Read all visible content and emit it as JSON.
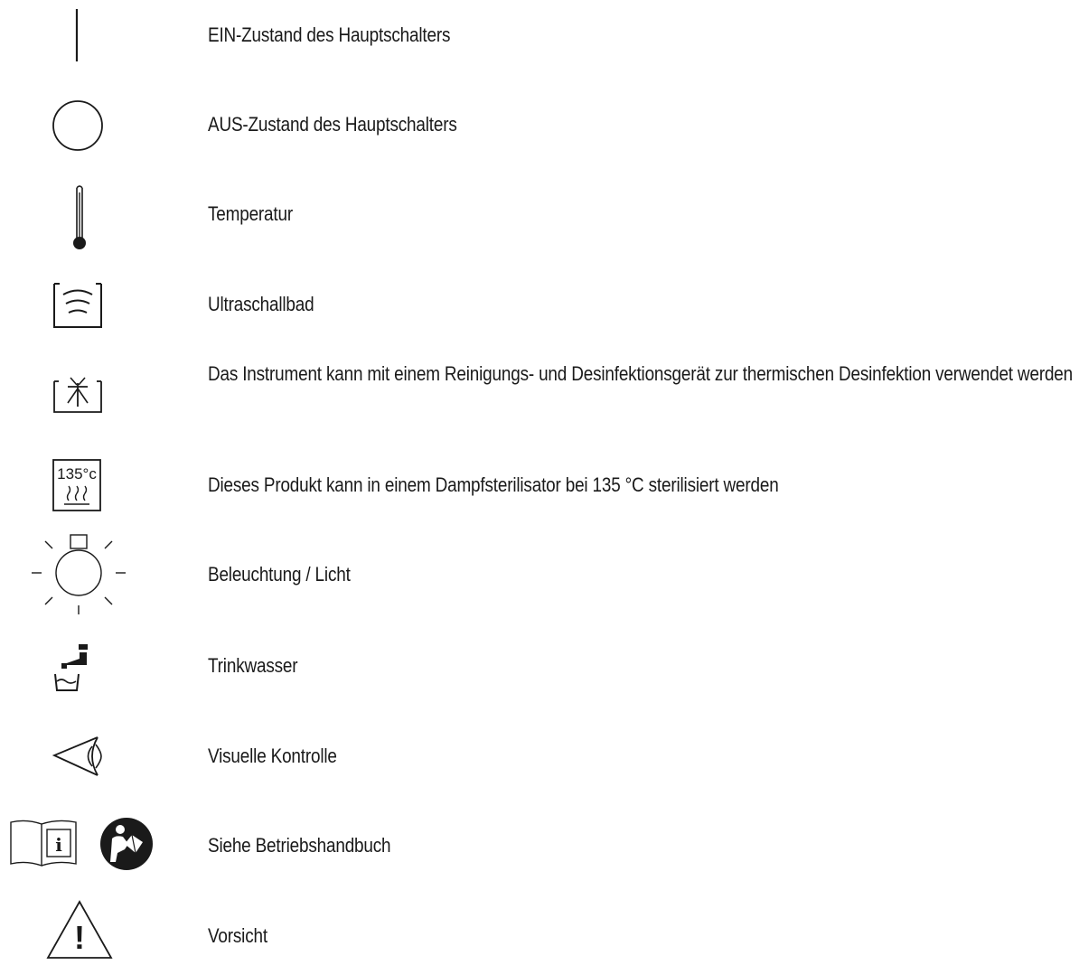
{
  "symbols": [
    {
      "icon": "on-state-line-icon",
      "label": "EIN-Zustand des Hauptschalters"
    },
    {
      "icon": "off-state-circle-icon",
      "label": "AUS-Zustand des Hauptschalters"
    },
    {
      "icon": "thermometer-icon",
      "label": "Temperatur"
    },
    {
      "icon": "ultrasonic-bath-icon",
      "label": "Ultraschallbad"
    },
    {
      "icon": "washer-disinfector-icon",
      "label": "Das Instrument kann mit einem Reinigungs- und Desinfektionsgerät zur thermischen Desinfektion verwendet werden"
    },
    {
      "icon": "steam-sterilizer-135-icon",
      "label": "Dieses Produkt kann in einem Dampfsterilisator bei 135 °C sterilisiert werden",
      "icon_text": "135°c"
    },
    {
      "icon": "illumination-lamp-icon",
      "label": "Beleuchtung / Licht"
    },
    {
      "icon": "drinking-water-icon",
      "label": "Trinkwasser"
    },
    {
      "icon": "eye-icon",
      "label": "Visuelle Kontrolle"
    },
    {
      "icon": "operating-manual-icon",
      "label": "Siehe Betriebshandbuch",
      "icon_text": "i"
    },
    {
      "icon": "caution-warning-icon",
      "label": "Vorsicht",
      "icon_text": "!"
    }
  ]
}
